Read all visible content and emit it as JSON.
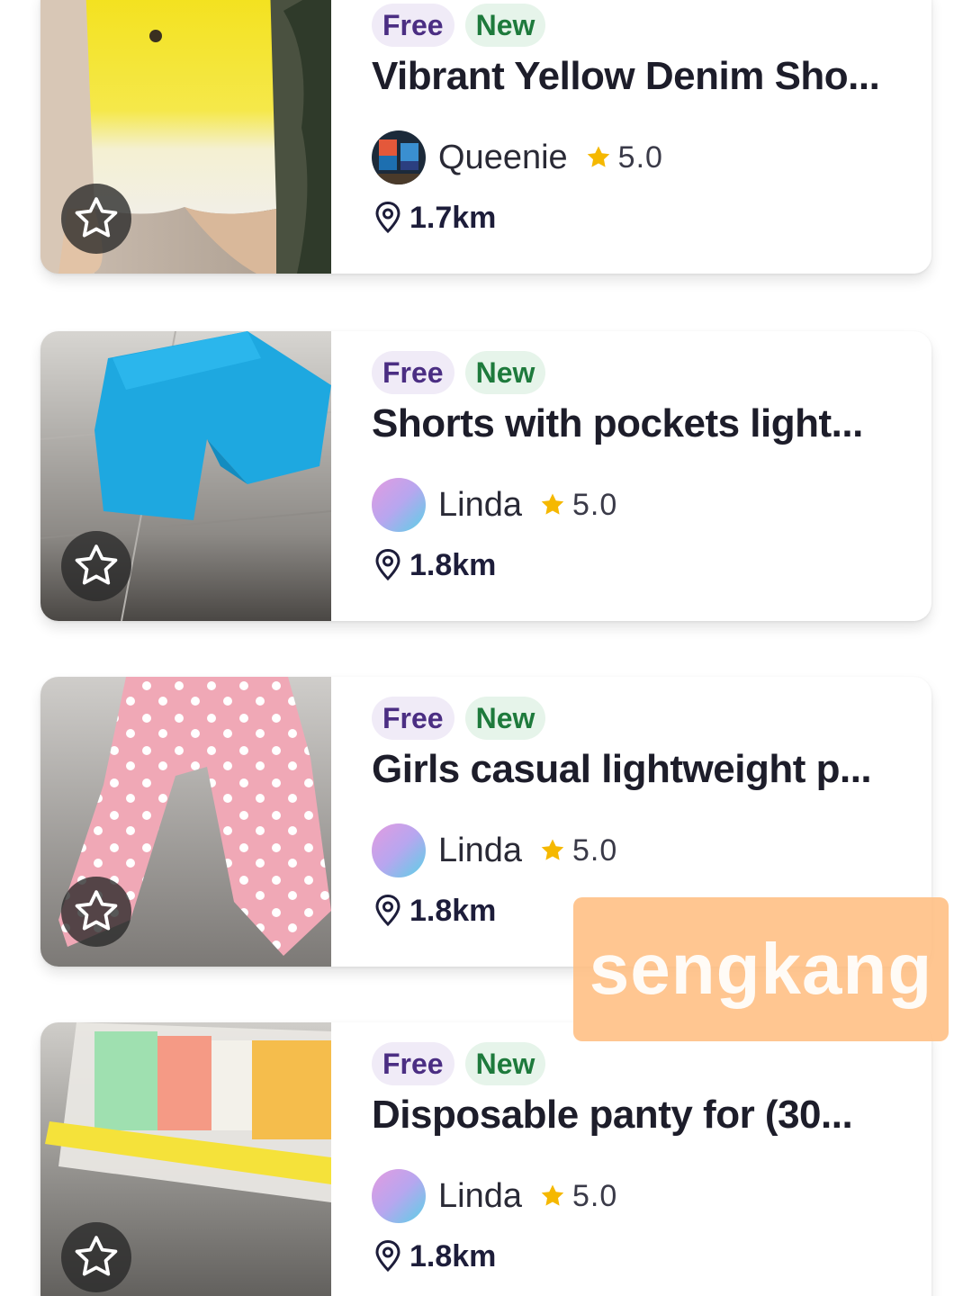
{
  "listings": [
    {
      "badges": {
        "free": "Free",
        "new": "New"
      },
      "title": "Vibrant Yellow Denim Sho...",
      "seller": {
        "name": "Queenie",
        "rating": "5.0"
      },
      "distance": "1.7km"
    },
    {
      "badges": {
        "free": "Free",
        "new": "New"
      },
      "title": "Shorts with pockets light...",
      "seller": {
        "name": "Linda",
        "rating": "5.0"
      },
      "distance": "1.8km"
    },
    {
      "badges": {
        "free": "Free",
        "new": "New"
      },
      "title": "Girls casual lightweight p...",
      "seller": {
        "name": "Linda",
        "rating": "5.0"
      },
      "distance": "1.8km"
    },
    {
      "badges": {
        "free": "Free",
        "new": "New"
      },
      "title": "Disposable panty for (30...",
      "seller": {
        "name": "Linda",
        "rating": "5.0"
      },
      "distance": "1.8km"
    }
  ],
  "watermark": "sengkang",
  "icons": {
    "favorite": "star-outline-icon",
    "rating": "star-filled-icon",
    "location": "map-pin-icon"
  },
  "colors": {
    "free_badge_bg": "#f0ebf7",
    "free_badge_text": "#4b2e83",
    "new_badge_bg": "#e6f4ea",
    "new_badge_text": "#1e7a3c",
    "star": "#f5b800",
    "watermark_bg": "#ffbe82"
  }
}
